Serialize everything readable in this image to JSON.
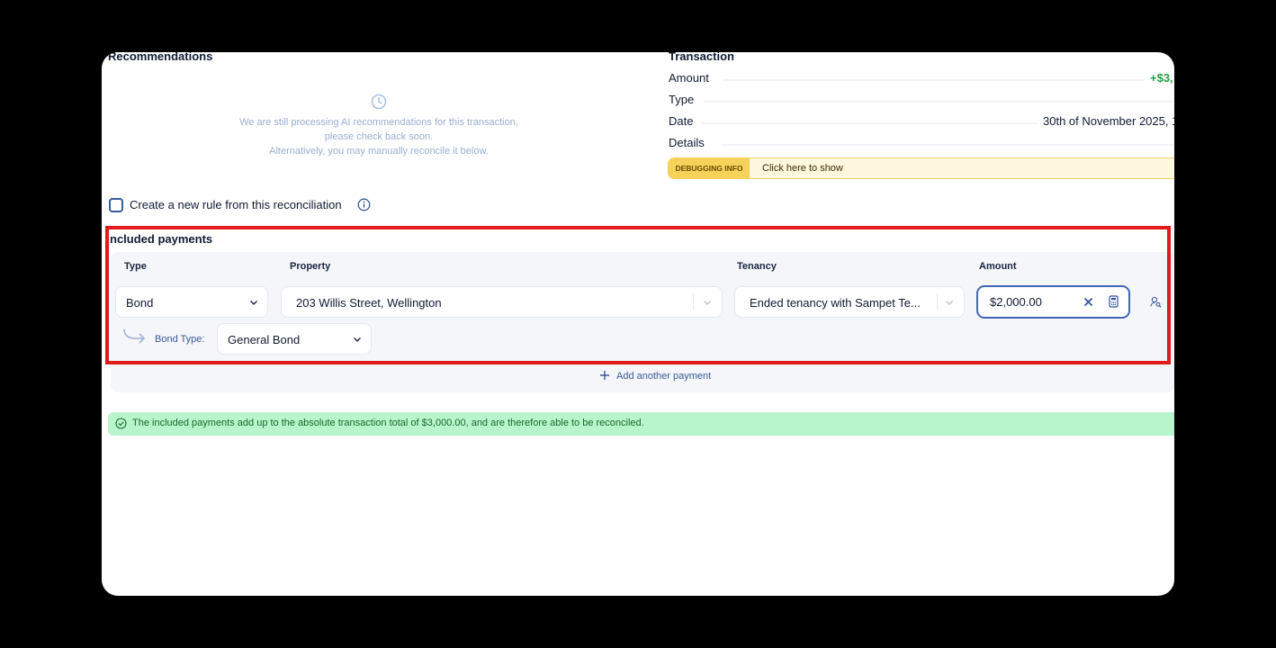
{
  "recommendations": {
    "title": "Recommendations",
    "message_line1": "We are still processing AI recommendations for this transaction,",
    "message_line2": "please check back soon.",
    "message_line3": "Alternatively, you may manually reconcile it below."
  },
  "transaction": {
    "title": "Transaction",
    "amount_label": "Amount",
    "amount_value": "+$3,",
    "type_label": "Type",
    "date_label": "Date",
    "date_value": "30th of November 2025, 1",
    "details_label": "Details",
    "debug_tag": "DEBUGGING INFO",
    "debug_link": "Click here to show"
  },
  "rule": {
    "label": "Create a new rule from this reconciliation",
    "checked": false
  },
  "included_payments": {
    "title": "ncluded payments",
    "headers": {
      "type": "Type",
      "property": "Property",
      "tenancy": "Tenancy",
      "amount": "Amount"
    },
    "row": {
      "type": "Bond",
      "property": "203 Willis Street, Wellington",
      "tenancy": "Ended tenancy with Sampet Te...",
      "amount": "$2,000.00",
      "bond_type_label": "Bond Type:",
      "bond_type": "General Bond"
    },
    "add_label": "Add another payment"
  },
  "status": {
    "message": "The included payments add up to the absolute transaction total of $3,000.00, and are therefore able to be reconciled."
  },
  "colors": {
    "accent": "#3f66b8",
    "positive": "#27a048",
    "highlight": "#e01b1b",
    "success_bg": "#b8f4cc"
  }
}
